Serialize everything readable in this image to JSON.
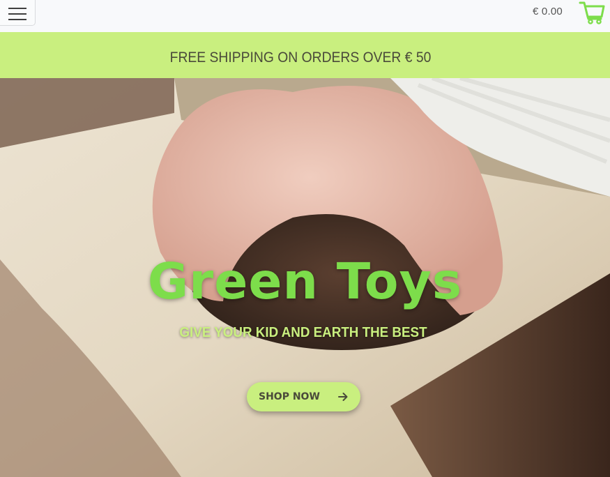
{
  "header": {
    "menu_icon": "hamburger-menu-icon",
    "cart_total": "€ 0.00",
    "cart_icon": "shopping-cart-icon"
  },
  "promo": {
    "text": "FREE SHIPPING ON ORDERS OVER € 50"
  },
  "hero": {
    "title": "Green Toys",
    "subtitle": "GIVE YOUR KID AND EARTH THE BEST",
    "cta_label": "SHOP NOW",
    "cta_icon": "arrow-right-icon"
  },
  "colors": {
    "brand_green": "#7ddd4b",
    "accent_lime": "#c9ef7f",
    "dark_text": "#4a4a3a"
  }
}
